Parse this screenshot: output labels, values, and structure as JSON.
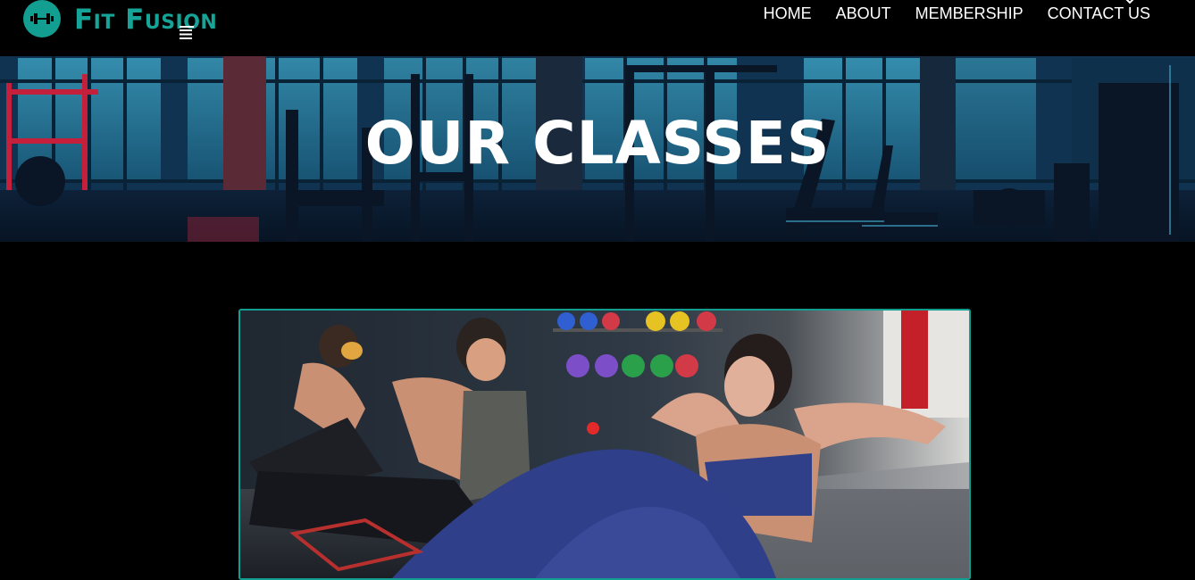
{
  "brand": {
    "name": "Fit Fusion",
    "logo_icon": "dumbbell-icon",
    "accent_color": "#139e92"
  },
  "nav": {
    "items": [
      {
        "label": "HOME"
      },
      {
        "label": "ABOUT"
      },
      {
        "label": "MEMBERSHIP"
      },
      {
        "label": "CONTACT US"
      }
    ],
    "menu_icon": "hamburger-icon",
    "close_icon": "close-icon"
  },
  "hero": {
    "title": "OUR CLASSES"
  },
  "colors": {
    "background": "#000000",
    "card_border": "#139e92"
  }
}
